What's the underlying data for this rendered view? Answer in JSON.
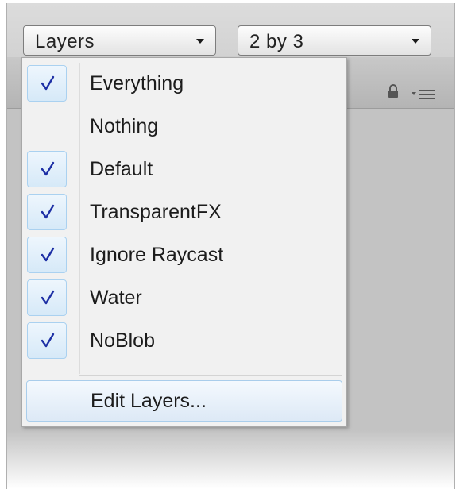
{
  "toolbar": {
    "layers_dropdown": {
      "label": "Layers"
    },
    "layout_dropdown": {
      "label": "2 by 3"
    }
  },
  "header_icons": [
    "lock-icon",
    "menu-options-icon"
  ],
  "layers_menu": {
    "items": [
      {
        "label": "Everything",
        "checked": true
      },
      {
        "label": "Nothing",
        "checked": false
      },
      {
        "label": "Default",
        "checked": true
      },
      {
        "label": "TransparentFX",
        "checked": true
      },
      {
        "label": "Ignore Raycast",
        "checked": true
      },
      {
        "label": "Water",
        "checked": true
      },
      {
        "label": "NoBlob",
        "checked": true
      }
    ],
    "edit_label": "Edit Layers..."
  },
  "colors": {
    "checkmark": "#1d2fa5",
    "check_highlight_border": "#aad1f0",
    "menu_background": "#f1f1f1"
  }
}
